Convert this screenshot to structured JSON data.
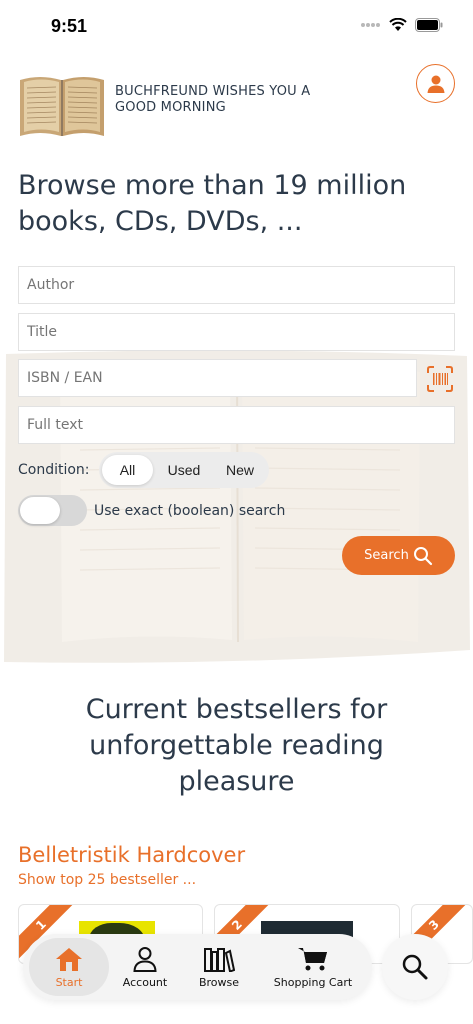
{
  "status": {
    "time": "9:51"
  },
  "header": {
    "greeting": "BUCHFREUND WISHES YOU A GOOD MORNING"
  },
  "headline": "Browse more than 19 million books, CDs, DVDs, ...",
  "form": {
    "author_placeholder": "Author",
    "title_placeholder": "Title",
    "isbn_placeholder": "ISBN / EAN",
    "fulltext_placeholder": "Full text",
    "condition_label": "Condition:",
    "condition_options": [
      "All",
      "Used",
      "New"
    ],
    "condition_selected": "All",
    "exact_search_label": "Use exact (boolean) search",
    "exact_search_on": false,
    "search_button": "Search"
  },
  "bestsellers": {
    "title": "Current bestsellers for unforgettable reading pleasure",
    "category_title": "Belletristik Hardcover",
    "category_link": "Show top 25 bestseller ...",
    "cards": [
      {
        "rank": "1"
      },
      {
        "rank": "2"
      },
      {
        "rank": "3"
      }
    ]
  },
  "tabbar": {
    "tabs": [
      {
        "label": "Start",
        "icon": "home-icon",
        "active": true
      },
      {
        "label": "Account",
        "icon": "person-icon",
        "active": false
      },
      {
        "label": "Browse",
        "icon": "books-icon",
        "active": false
      },
      {
        "label": "Shopping Cart",
        "icon": "cart-icon",
        "active": false
      }
    ],
    "search_icon": "search-icon"
  },
  "colors": {
    "accent": "#e8702a",
    "text": "#2c3a4a",
    "field_border": "#e2e2e2"
  }
}
